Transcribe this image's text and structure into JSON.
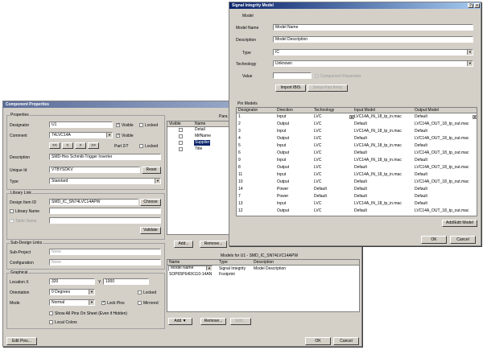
{
  "cp": {
    "title": "Component Properties",
    "properties": "Properties",
    "designator_label": "Designator",
    "designator_value": "U1",
    "visible": "Visible",
    "locked": "Locked",
    "comment_label": "Comment",
    "comment_value": "74LVC14A",
    "nav": [
      "<<",
      "<",
      ">",
      ">>"
    ],
    "part": "Part 2/7",
    "description_label": "Description",
    "description_value": "SMD-Hex Schmitt-Trigger Inverter",
    "unique_id_label": "Unique Id",
    "unique_id_value": "VTBYSDKV",
    "reset": "Reset",
    "type_label": "Type",
    "type_value": "Standard",
    "library_link": "Library Link",
    "design_item_label": "Design Item ID",
    "design_item_value": "SMD_IC_SN74LVC14APW",
    "choose": "Choose",
    "library_name": "Library Name",
    "table_name": "Table Name",
    "validate": "Validate",
    "sub_design": "Sub-Design Links",
    "sub_project_label": "Sub-Project",
    "sub_project_value": "None",
    "configuration_label": "Configuration",
    "configuration_value": "None",
    "graphical": "Graphical",
    "location_label": "Location X",
    "location_x": "320",
    "location_y_label": "Y",
    "location_y": "1000",
    "orientation_label": "Orientation",
    "orientation_value": "0 Degrees",
    "mode_label": "Mode",
    "mode_value": "Normal",
    "lock_pins": "Lock Pins",
    "mirrored": "Mirrored",
    "show_all_pins": "Show All Pins On Sheet (Even if Hidden)",
    "local_colors": "Local Colors",
    "params_tab": "Para",
    "params_headers": [
      "Visible",
      "Name"
    ],
    "params_rows": [
      "Detail",
      "MifName",
      "Supplier",
      "Title"
    ],
    "add": "Add...",
    "remove": "Remove...",
    "models_title": "Models for U1 - SMD_IC_SN74LVC14APW",
    "models_headers": [
      "Name",
      "Type",
      "Description"
    ],
    "models_row": {
      "name": "SOP65P640X110-14AN",
      "type": "Footprint"
    },
    "models_dropdown": {
      "name": "Model Name",
      "type": "Signal Integrity",
      "desc": "Model Description"
    },
    "models_add": "Add",
    "models_remove": "Remove...",
    "models_edit": "Edit...",
    "edit_pins": "Edit Pins...",
    "ok": "OK",
    "cancel": "Cancel"
  },
  "si": {
    "title": "Signal Integrity Model",
    "model_group": "Model",
    "model_name_label": "Model Name",
    "model_name_value": "Model Name",
    "description_label": "Description",
    "description_value": "Model Description",
    "type_label": "Type",
    "type_value": "IC",
    "technology_label": "Technology",
    "technology_value": "Unknown",
    "value_label": "Value",
    "component_parameter": "Component Parameter",
    "import_ibis": "Import IBIS",
    "setup_part_array": "Setup Part Array",
    "pin_models": "Pin Models",
    "headers": [
      "Designator",
      "Direction",
      "Technology",
      "Input Model",
      "Output Model"
    ],
    "rows": [
      [
        "1",
        "Input",
        "LVC",
        "LVC14A_IN_18_tp_in.mac",
        "Default"
      ],
      [
        "2",
        "Output",
        "LVC",
        "Default",
        "LVC14A_OUT_18_tp_out.mac"
      ],
      [
        "3",
        "Input",
        "LVC",
        "LVC14A_IN_18_tp_in.mac",
        "Default"
      ],
      [
        "4",
        "Output",
        "LVC",
        "Default",
        "LVC14A_OUT_18_tp_out.mac"
      ],
      [
        "5",
        "Input",
        "LVC",
        "LVC14A_IN_18_tp_in.mac",
        "Default"
      ],
      [
        "6",
        "Output",
        "LVC",
        "Default",
        "LVC14A_OUT_18_tp_out.mac"
      ],
      [
        "9",
        "Input",
        "LVC",
        "LVC14A_IN_18_tp_in.mac",
        "Default"
      ],
      [
        "8",
        "Output",
        "LVC",
        "Default",
        "LVC14A_OUT_18_tp_out.mac"
      ],
      [
        "11",
        "Input",
        "LVC",
        "LVC14A_IN_18_tp_in.mac",
        "Default"
      ],
      [
        "10",
        "Output",
        "LVC",
        "Default",
        "LVC14A_OUT_18_tp_out.mac"
      ],
      [
        "14",
        "Power",
        "Default",
        "Default",
        "Default"
      ],
      [
        "7",
        "Power",
        "Default",
        "Default",
        "Default"
      ],
      [
        "13",
        "Input",
        "LVC",
        "LVC14A_IN_18_tp_in.mac",
        "Default"
      ],
      [
        "12",
        "Output",
        "LVC",
        "Default",
        "LVC14A_OUT_18_tp_out.mac"
      ]
    ],
    "add_edit_model": "Add/Edit Model",
    "ok": "OK",
    "cancel": "Cancel"
  },
  "glyphs": {
    "close": "x",
    "help": "?",
    "dd": "▼",
    "check": "✓"
  }
}
